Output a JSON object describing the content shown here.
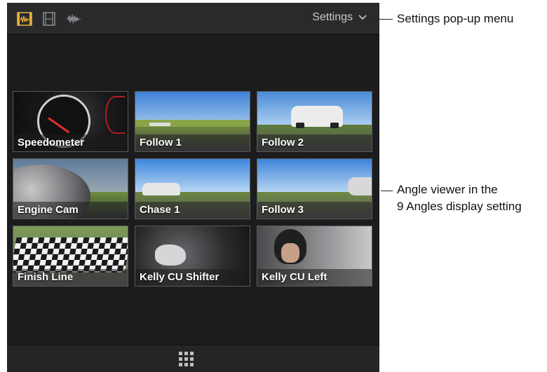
{
  "toolbar": {
    "icons": [
      "video-audio-icon",
      "video-only-icon",
      "audio-waveform-icon"
    ],
    "settings_label": "Settings",
    "settings_chevron": "⌄"
  },
  "angles": [
    {
      "label": "Speedometer"
    },
    {
      "label": "Follow 1"
    },
    {
      "label": "Follow 2"
    },
    {
      "label": "Engine Cam"
    },
    {
      "label": "Chase 1"
    },
    {
      "label": "Follow 3"
    },
    {
      "label": "Finish Line"
    },
    {
      "label": "Kelly CU Shifter"
    },
    {
      "label": "Kelly CU Left"
    }
  ],
  "callouts": {
    "settings_menu": "Settings pop-up menu",
    "angle_viewer_line1": "Angle viewer in the",
    "angle_viewer_line2": "9 Angles display setting"
  },
  "colors": {
    "accent_yellow": "#e8b23a",
    "panel_bg": "#1c1c1e"
  }
}
